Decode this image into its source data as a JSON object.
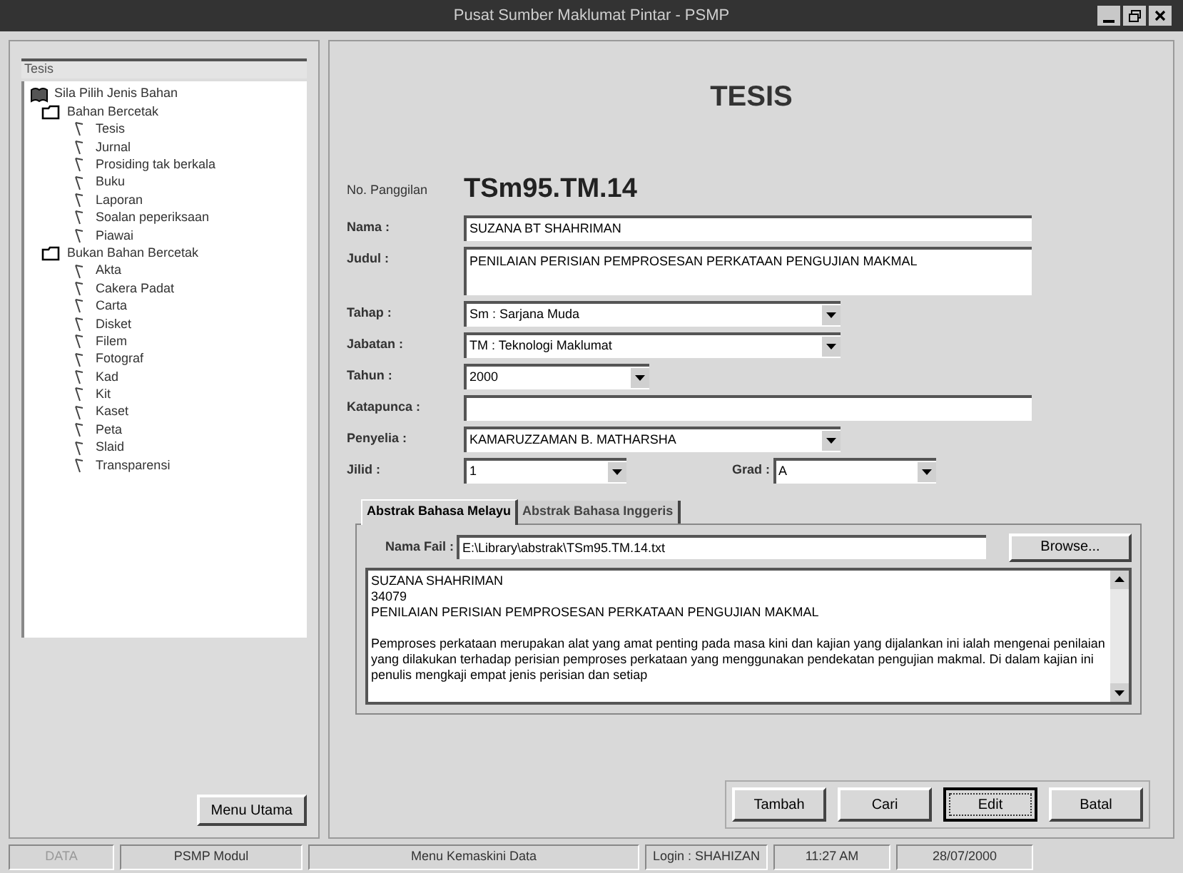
{
  "window": {
    "title": "Pusat Sumber Maklumat Pintar - PSMP"
  },
  "sidebar": {
    "search": {
      "value": "Tesis"
    },
    "tree": [
      {
        "label": "Sila Pilih Jenis Bahan",
        "children": [
          {
            "label": "Bahan Bercetak",
            "children": [
              {
                "label": "Tesis"
              },
              {
                "label": "Jurnal"
              },
              {
                "label": "Prosiding tak berkala"
              },
              {
                "label": "Buku"
              },
              {
                "label": "Laporan"
              },
              {
                "label": "Soalan peperiksaan"
              },
              {
                "label": "Piawai"
              }
            ]
          },
          {
            "label": "Bukan Bahan Bercetak",
            "children": [
              {
                "label": "Akta"
              },
              {
                "label": "Cakera Padat"
              },
              {
                "label": "Carta"
              },
              {
                "label": "Disket"
              },
              {
                "label": "Filem"
              },
              {
                "label": "Fotograf"
              },
              {
                "label": "Kad"
              },
              {
                "label": "Kit"
              },
              {
                "label": "Kaset"
              },
              {
                "label": "Peta"
              },
              {
                "label": "Slaid"
              },
              {
                "label": "Transparensi"
              }
            ]
          }
        ]
      }
    ],
    "button": "Menu Utama"
  },
  "form": {
    "heading": "TESIS",
    "call_number": {
      "label": "No. Panggilan",
      "value": "TSm95.TM.14"
    },
    "fields": [
      {
        "kind": "text",
        "label": "Nama :",
        "value": "SUZANA BT  SHAHRIMAN"
      },
      {
        "kind": "textarea",
        "label": "Judul :",
        "value": "PENILAIAN PERISIAN PEMPROSESAN PERKATAAN  PENGUJIAN MAKMAL"
      },
      {
        "kind": "combo",
        "label": "Tahap :",
        "value": "Sm : Sarjana Muda"
      },
      {
        "kind": "combo",
        "label": "Jabatan :",
        "value": "TM : Teknologi Maklumat"
      },
      {
        "kind": "shortcombo",
        "label": "Tahun :",
        "value": "2000"
      },
      {
        "kind": "text",
        "label": "Katapunca :"
      },
      {
        "kind": "combo",
        "label": "Penyelia :",
        "value": "KAMARUZZAMAN B. MATHARSHA"
      }
    ],
    "jilid": {
      "label": "Jilid :",
      "value": "1"
    },
    "grad": {
      "label": "Grad :",
      "value": "A"
    },
    "tabs": [
      {
        "label": "Abstrak Bahasa Melayu",
        "selected": true
      },
      {
        "label": "Abstrak Bahasa Inggeris",
        "selected": false
      }
    ],
    "file": {
      "label": "Nama Fail :",
      "value": "E:\\Library\\abstrak\\TSm95.TM.14.txt",
      "button": "Browse..."
    },
    "abstract": [
      "SUZANA SHAHRIMAN",
      "34079",
      "PENILAIAN PERISIAN PEMPROSESAN PERKATAAN PENGUJIAN MAKMAL",
      "Pemproses perkataan merupakan alat yang amat  penting pada masa kini dan kajian yang dijalankan ini ialah mengenai penilaian yang dilakukan terhadap perisian pemproses perkataan yang menggunakan pendekatan pengujian makmal. Di dalam kajian ini penulis mengkaji empat jenis perisian dan setiap"
    ],
    "buttons": [
      {
        "label": "Tambah",
        "focused": false
      },
      {
        "label": "Cari",
        "focused": false
      },
      {
        "label": "Edit",
        "focused": true
      },
      {
        "label": "Batal",
        "focused": false
      }
    ]
  },
  "status_bar": [
    "DATA",
    "PSMP Modul",
    "Menu Kemaskini Data",
    "Login : SHAHIZAN",
    "11:27 AM",
    "28/07/2000"
  ]
}
